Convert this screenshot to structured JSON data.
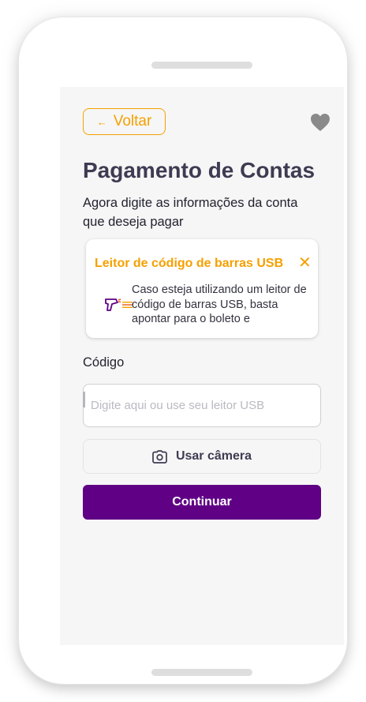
{
  "header": {
    "back_label": "Voltar",
    "back_arrow": "←",
    "favorite_icon": "heart-icon"
  },
  "page": {
    "title": "Pagamento de  Contas",
    "subtitle": "Agora digite as informações da conta que deseja pagar"
  },
  "notice": {
    "title": "Leitor de código de barras USB",
    "close_glyph": "✕",
    "text": "Caso esteja utilizando um leitor de código de barras USB, basta apontar para o boleto e",
    "icon": "barcode-scanner-icon"
  },
  "form": {
    "code_label": "Código",
    "code_value": "",
    "code_placeholder": "Digite aqui ou use seu leitor USB",
    "camera_label": "Usar câmera",
    "camera_icon": "camera-icon",
    "continue_label": "Continuar"
  },
  "colors": {
    "accent": "#f5a000",
    "primary": "#5f0085",
    "title": "#3e3b52",
    "screen_bg": "#f6f6f6"
  }
}
